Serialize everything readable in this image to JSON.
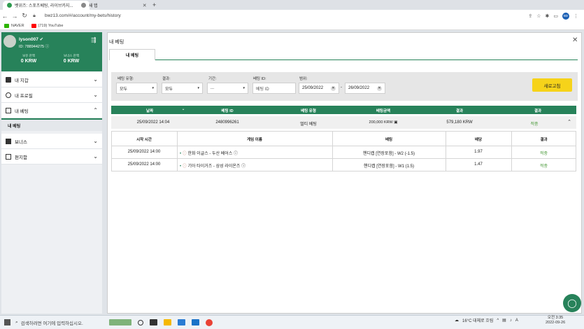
{
  "browser": {
    "tabs": [
      {
        "title": "벳위즈: 스포츠베팅, 라이브카지...",
        "active": true
      },
      {
        "title": "새 탭",
        "active": false
      }
    ],
    "new_tab": "+",
    "url": "bwz13.com/#/account/my-bets/history",
    "bookmarks": [
      {
        "label": "NAVER",
        "color": "#2db400"
      },
      {
        "label": "(719) YouTube",
        "color": "#ff0000"
      }
    ],
    "profile_initials": "BD"
  },
  "user": {
    "name": "lyson007",
    "id_label": "ID: 788944275",
    "balances": [
      {
        "label": "보유 잔액",
        "value": "0 KRW"
      },
      {
        "label": "보너스 잔액",
        "value": "0 KRW"
      }
    ]
  },
  "sidebar": {
    "items": [
      {
        "label": "내 지갑",
        "icon": "wallet-icon"
      },
      {
        "label": "내 프로필",
        "icon": "profile-icon"
      },
      {
        "label": "내 베팅",
        "icon": "bets-icon",
        "expanded": true
      },
      {
        "label": "보너스",
        "icon": "gift-icon"
      },
      {
        "label": "편지함",
        "icon": "mail-icon"
      }
    ],
    "subitem": "내 베팅"
  },
  "main": {
    "title": "내 베팅",
    "tab": "내 베팅",
    "filters": {
      "bet_type": {
        "label": "베팅 유형:",
        "value": "모두"
      },
      "result": {
        "label": "결과:",
        "value": "모두"
      },
      "period": {
        "label": "기간:",
        "value": "..."
      },
      "bet_id": {
        "label": "베팅 ID:",
        "placeholder": "베팅 ID"
      },
      "range": {
        "label": "범위:",
        "from": "25/09/2022",
        "to": "26/09/2022",
        "sep": "-"
      }
    },
    "refresh": "새로고침",
    "table": {
      "headers": [
        "날짜",
        "베팅 ID",
        "베팅 유형",
        "베팅금액",
        "결과",
        "결과"
      ],
      "row": {
        "date": "25/09/2022 14:04",
        "bet_id": "2480996261",
        "type": "멀티 베팅",
        "amount": "200,000 KRW",
        "payout": "579,180 KRW",
        "status": "적중"
      },
      "sub_headers": [
        "시작 시간",
        "게임 이름",
        "베팅",
        "배당",
        "결과"
      ],
      "sub_rows": [
        {
          "time": "25/09/2022 14:00",
          "game": "한화 이글스 - 두산 베어스",
          "bet": "핸디캡 [연장포함] - W2 (-1.5)",
          "odds": "1.97",
          "result": "적중"
        },
        {
          "time": "25/09/2022 14:00",
          "game": "기아 타이거즈 - 삼성 라이온즈",
          "bet": "핸디캡 [연장포함] - W1 (1.5)",
          "odds": "1.47",
          "result": "적중"
        }
      ]
    }
  },
  "taskbar": {
    "search_placeholder": "검색하려면 여기에 입력하십시오.",
    "weather": "16°C 대체로 흐림",
    "time": "오전 3:35",
    "date": "2022-09-26"
  },
  "colors": {
    "brand": "#27825a",
    "accent": "#f6d31a",
    "win": "#4a9a3a"
  }
}
